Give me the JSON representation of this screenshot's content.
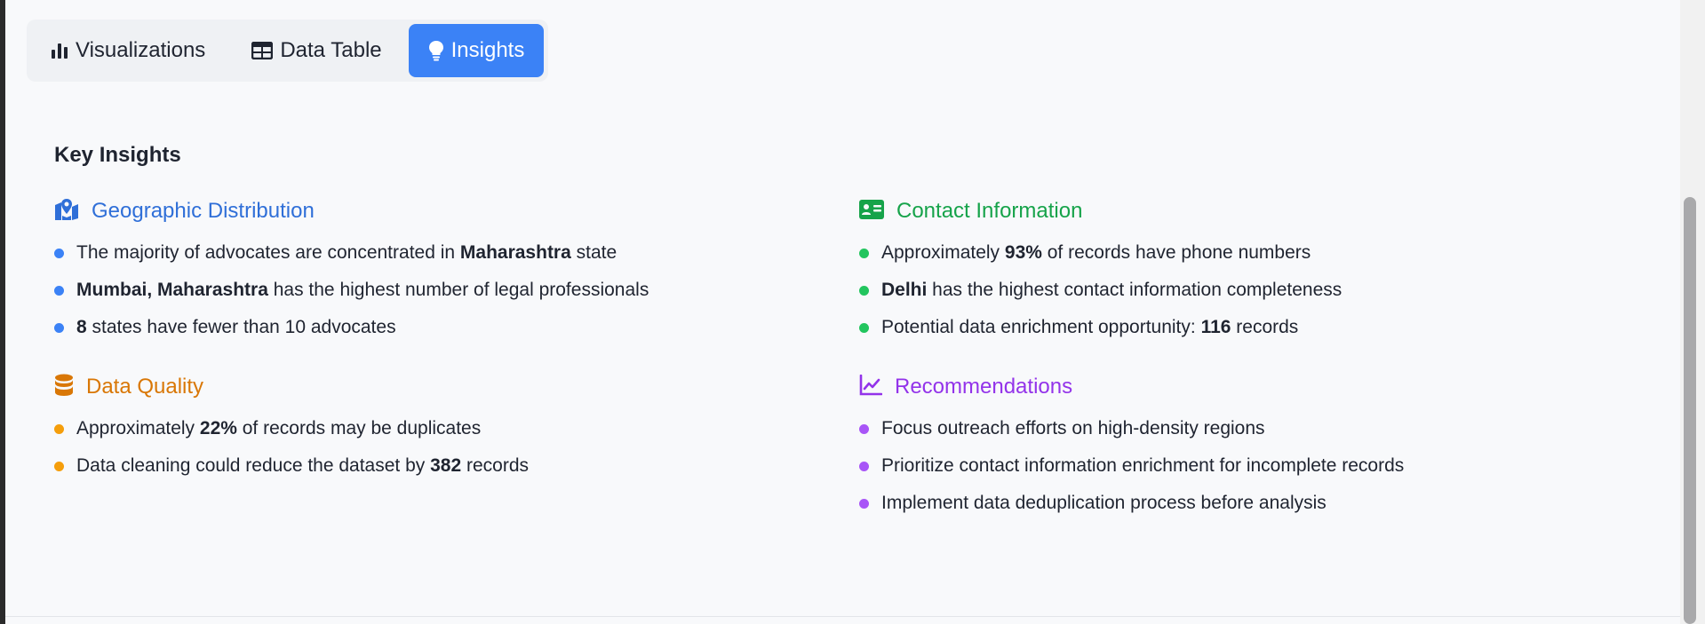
{
  "tabs": [
    {
      "label": "Visualizations",
      "icon": "bar-chart-icon",
      "active": false
    },
    {
      "label": "Data Table",
      "icon": "table-icon",
      "active": false
    },
    {
      "label": "Insights",
      "icon": "lightbulb-icon",
      "active": true
    }
  ],
  "title": "Key Insights",
  "colors": {
    "accent_blue": "#3b82f6",
    "geo": "#2f6fd8",
    "contact": "#16a34a",
    "quality": "#d97706",
    "recommend": "#9333ea"
  },
  "sections": {
    "geographic": {
      "heading": "Geographic Distribution",
      "icon": "map-pin-icon",
      "items": [
        {
          "pre": "The majority of advocates are concentrated in ",
          "bold": "Maharashtra",
          "post": " state"
        },
        {
          "pre": "",
          "bold": "Mumbai, Maharashtra",
          "post": " has the highest number of legal professionals"
        },
        {
          "pre": "",
          "bold": "8",
          "post": " states have fewer than 10 advocates"
        }
      ]
    },
    "contact": {
      "heading": "Contact Information",
      "icon": "id-card-icon",
      "items": [
        {
          "pre": "Approximately ",
          "bold": "93%",
          "post": " of records have phone numbers"
        },
        {
          "pre": "",
          "bold": "Delhi",
          "post": " has the highest contact information completeness"
        },
        {
          "pre": "Potential data enrichment opportunity: ",
          "bold": "116",
          "post": " records"
        }
      ]
    },
    "quality": {
      "heading": "Data Quality",
      "icon": "database-icon",
      "items": [
        {
          "pre": "Approximately ",
          "bold": "22%",
          "post": " of records may be duplicates"
        },
        {
          "pre": "Data cleaning could reduce the dataset by ",
          "bold": "382",
          "post": " records"
        }
      ]
    },
    "recommendations": {
      "heading": "Recommendations",
      "icon": "line-chart-icon",
      "items": [
        {
          "text": "Focus outreach efforts on high-density regions"
        },
        {
          "text": "Prioritize contact information enrichment for incomplete records"
        },
        {
          "text": "Implement data deduplication process before analysis"
        }
      ]
    }
  }
}
